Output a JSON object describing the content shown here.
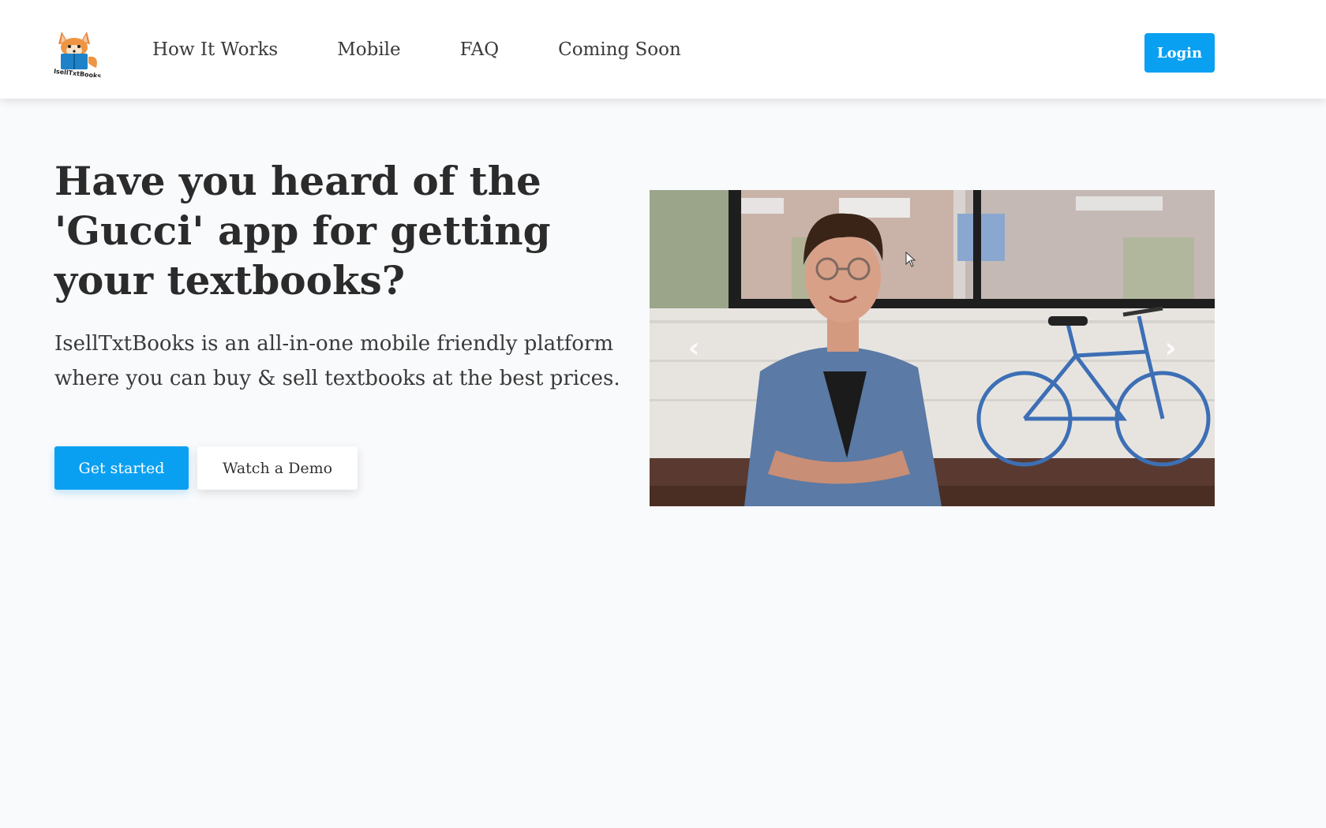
{
  "header": {
    "logo_icon": "fox-reading-book-logo",
    "logo_text": "IsellTxtBooks",
    "nav": [
      {
        "label": "How It Works"
      },
      {
        "label": "Mobile"
      },
      {
        "label": "FAQ"
      },
      {
        "label": "Coming Soon"
      }
    ],
    "login_label": "Login"
  },
  "hero": {
    "headline": "Have you heard of the 'Gucci' app for getting your textbooks?",
    "subtext": "IsellTxtBooks is an all-in-one mobile friendly platform where you can buy & sell textbooks at the best prices.",
    "primary_button": "Get started",
    "secondary_button": "Watch a Demo"
  },
  "carousel": {
    "prev_icon": "chevron-left-icon",
    "next_icon": "chevron-right-icon",
    "prev_glyph": "‹",
    "next_glyph": "›",
    "image_icon": "person-with-bicycle-photo"
  },
  "colors": {
    "accent": "#0aa0f2",
    "background": "#f9fafc",
    "header_bg": "#ffffff",
    "text": "#2b2b2b"
  }
}
